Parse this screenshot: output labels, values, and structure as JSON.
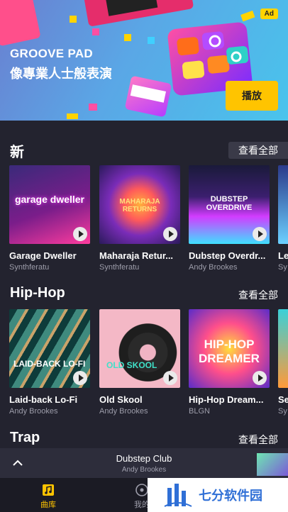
{
  "banner": {
    "ad_badge": "Ad",
    "title": "GROOVE PAD",
    "subtitle": "像專業人士般表演",
    "button": "播放",
    "colors": {
      "accent": "#ffc400"
    }
  },
  "sections": [
    {
      "title": "新",
      "see_all": "查看全部",
      "cards": [
        {
          "title": "Garage Dweller",
          "artist": "Synthferatu",
          "art_text": "garage dweller"
        },
        {
          "title": "Maharaja Retur...",
          "artist": "Synthferatu",
          "art_text": "MAHARAJA RETURNS"
        },
        {
          "title": "Dubstep Overdr...",
          "artist": "Andy Brookes",
          "art_text": "DUBSTEP OVERDRIVE"
        },
        {
          "title": "Le",
          "artist": "Sy"
        }
      ]
    },
    {
      "title": "Hip-Hop",
      "see_all": "查看全部",
      "cards": [
        {
          "title": "Laid-back Lo-Fi",
          "artist": "Andy Brookes",
          "art_text": "LAID-BACK LO-FI"
        },
        {
          "title": "Old Skool",
          "artist": "Andy Brookes",
          "art_text": "OLD SKOOL"
        },
        {
          "title": "Hip-Hop Dream...",
          "artist": "BLGN",
          "art_text": "HIP-HOP DREAMER"
        },
        {
          "title": "Se",
          "artist": "Sy"
        }
      ]
    },
    {
      "title": "Trap",
      "see_all": "查看全部"
    }
  ],
  "mini_player": {
    "title": "Dubstep Club",
    "artist": "Andy Brookes"
  },
  "bottom_nav": {
    "library": "曲库",
    "mine": "我的"
  },
  "watermark": {
    "text": "七分软件园"
  }
}
